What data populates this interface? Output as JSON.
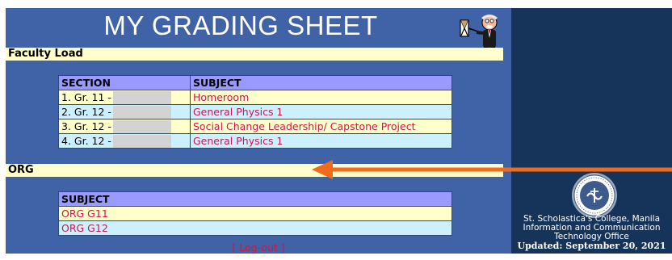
{
  "header": {
    "title": "MY GRADING SHEET",
    "mascot_icon": "professor-pointer-icon"
  },
  "faculty_load": {
    "heading": "Faculty Load",
    "columns": [
      "SECTION",
      "SUBJECT"
    ],
    "rows": [
      {
        "section": "1. Gr. 11 -",
        "subject": "Homeroom"
      },
      {
        "section": "2. Gr. 12 -",
        "subject": "General Physics 1"
      },
      {
        "section": "3. Gr. 12 -",
        "subject": "Social Change Leadership/ Capstone Project"
      },
      {
        "section": "4. Gr. 12 -",
        "subject": "General Physics 1"
      }
    ]
  },
  "org": {
    "heading": "ORG",
    "columns": [
      "SUBJECT"
    ],
    "rows": [
      {
        "subject": "ORG G11"
      },
      {
        "subject": "ORG G12"
      }
    ]
  },
  "logout": {
    "label": "[ Log-out ]"
  },
  "sidebar": {
    "seal_icon": "school-seal-icon",
    "institution_line1": "St. Scholastica's College, Manila",
    "institution_line2": "Information and Communication",
    "institution_line3": "Technology Office",
    "updated": "Updated: September 20, 2021"
  },
  "annotation": {
    "arrow_icon": "orange-arrow-icon",
    "color": "#f26a1b"
  },
  "colors": {
    "main_bg": "#4062a6",
    "side_bg": "#16335a",
    "bar_bg": "#ffffcc",
    "header_row": "#9999ff",
    "subject_text": "#c41a50"
  }
}
